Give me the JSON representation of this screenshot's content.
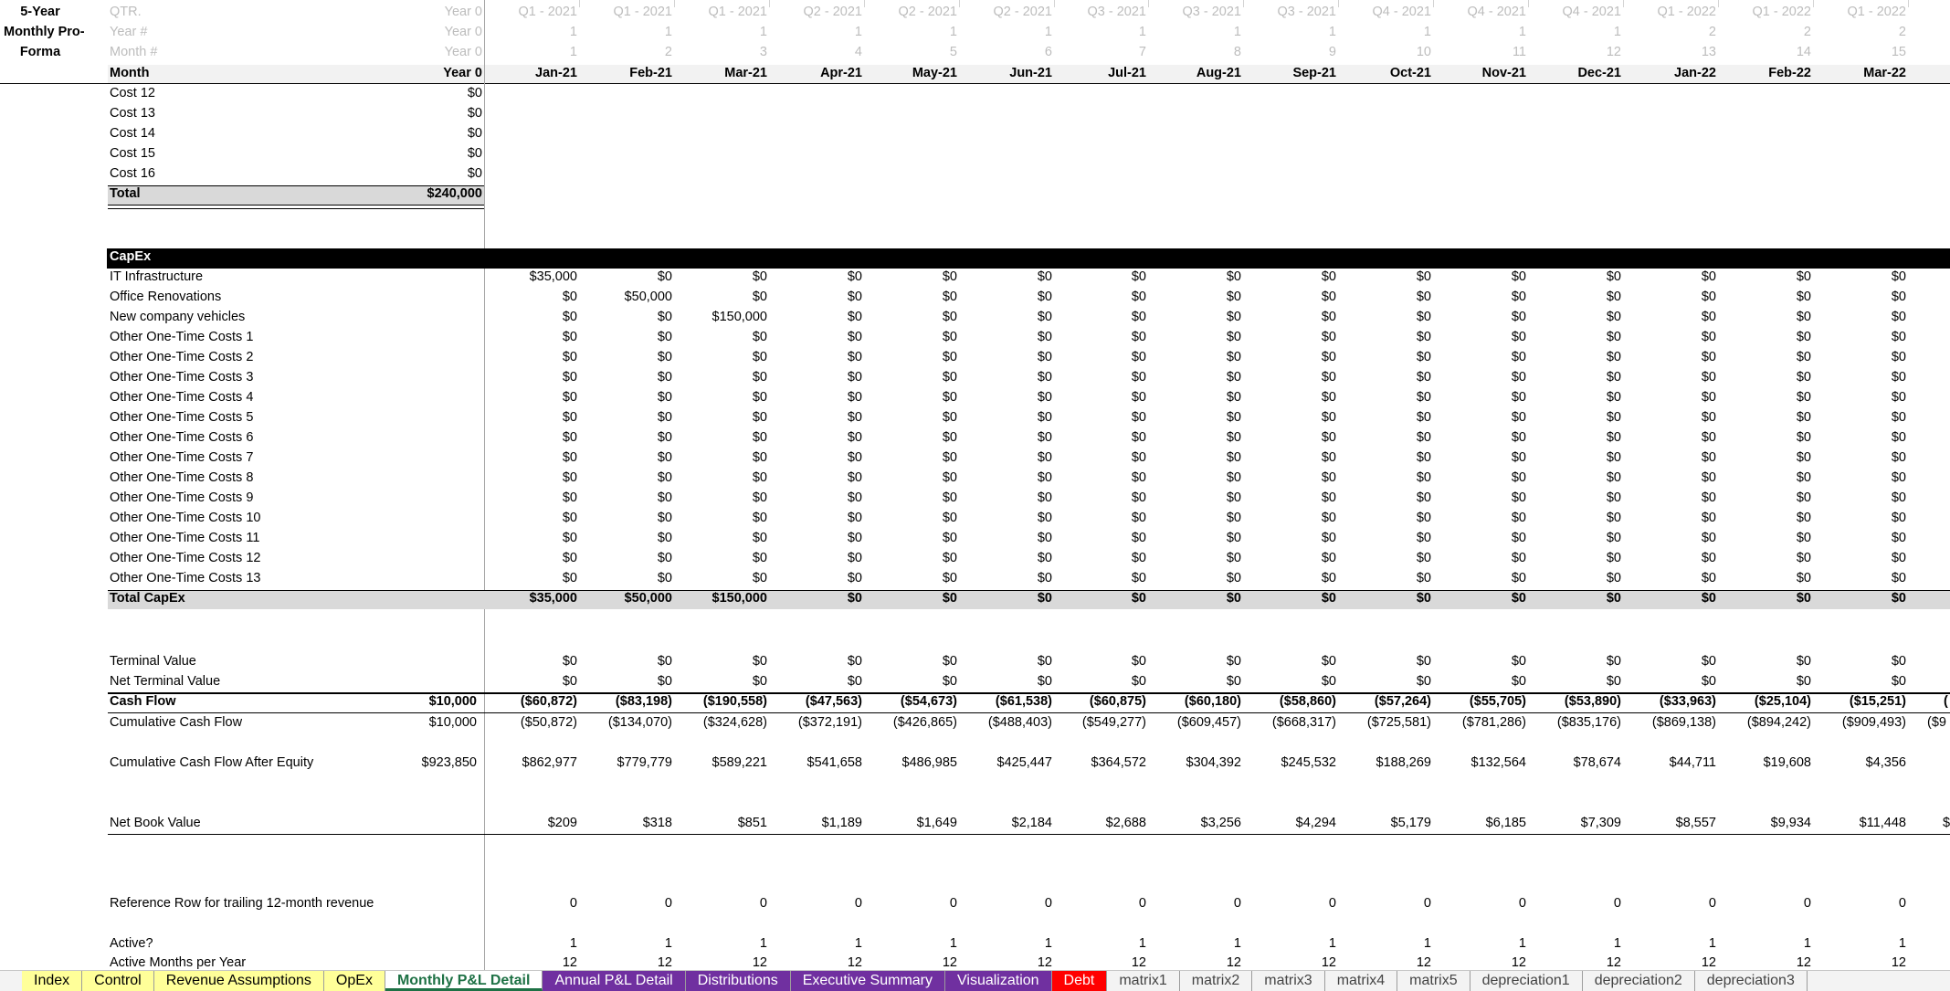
{
  "title": {
    "line1": "5-Year",
    "line2": "Monthly Pro-",
    "line3": "Forma"
  },
  "header_labels": {
    "qtr": "QTR.",
    "year_num": "Year #",
    "month_num": "Month #",
    "month": "Month"
  },
  "year0_header": {
    "qtr": "Year 0",
    "year_num": "Year 0",
    "month_num": "Year 0",
    "month": "Year 0"
  },
  "columns": [
    {
      "qtr": "Q1 - 2021",
      "year": "1",
      "mnum": "1",
      "month": "Jan-21"
    },
    {
      "qtr": "Q1 - 2021",
      "year": "1",
      "mnum": "2",
      "month": "Feb-21"
    },
    {
      "qtr": "Q1 - 2021",
      "year": "1",
      "mnum": "3",
      "month": "Mar-21"
    },
    {
      "qtr": "Q2 - 2021",
      "year": "1",
      "mnum": "4",
      "month": "Apr-21"
    },
    {
      "qtr": "Q2 - 2021",
      "year": "1",
      "mnum": "5",
      "month": "May-21"
    },
    {
      "qtr": "Q2 - 2021",
      "year": "1",
      "mnum": "6",
      "month": "Jun-21"
    },
    {
      "qtr": "Q3 - 2021",
      "year": "1",
      "mnum": "7",
      "month": "Jul-21"
    },
    {
      "qtr": "Q3 - 2021",
      "year": "1",
      "mnum": "8",
      "month": "Aug-21"
    },
    {
      "qtr": "Q3 - 2021",
      "year": "1",
      "mnum": "9",
      "month": "Sep-21"
    },
    {
      "qtr": "Q4 - 2021",
      "year": "1",
      "mnum": "10",
      "month": "Oct-21"
    },
    {
      "qtr": "Q4 - 2021",
      "year": "1",
      "mnum": "11",
      "month": "Nov-21"
    },
    {
      "qtr": "Q4 - 2021",
      "year": "1",
      "mnum": "12",
      "month": "Dec-21"
    },
    {
      "qtr": "Q1 - 2022",
      "year": "2",
      "mnum": "13",
      "month": "Jan-22"
    },
    {
      "qtr": "Q1 - 2022",
      "year": "2",
      "mnum": "14",
      "month": "Feb-22"
    },
    {
      "qtr": "Q1 - 2022",
      "year": "2",
      "mnum": "15",
      "month": "Mar-22"
    }
  ],
  "cost_rows": [
    {
      "label": "Cost 12",
      "year0": "$0"
    },
    {
      "label": "Cost 13",
      "year0": "$0"
    },
    {
      "label": "Cost 14",
      "year0": "$0"
    },
    {
      "label": "Cost 15",
      "year0": "$0"
    },
    {
      "label": "Cost 16",
      "year0": "$0"
    }
  ],
  "cost_total": {
    "label": "Total",
    "year0": "$240,000"
  },
  "capex_header": "CapEx",
  "capex_rows": [
    {
      "label": "IT Infrastructure",
      "values": [
        "$35,000",
        "$0",
        "$0",
        "$0",
        "$0",
        "$0",
        "$0",
        "$0",
        "$0",
        "$0",
        "$0",
        "$0",
        "$0",
        "$0",
        "$0"
      ]
    },
    {
      "label": "Office Renovations",
      "values": [
        "$0",
        "$50,000",
        "$0",
        "$0",
        "$0",
        "$0",
        "$0",
        "$0",
        "$0",
        "$0",
        "$0",
        "$0",
        "$0",
        "$0",
        "$0"
      ]
    },
    {
      "label": "New company vehicles",
      "values": [
        "$0",
        "$0",
        "$150,000",
        "$0",
        "$0",
        "$0",
        "$0",
        "$0",
        "$0",
        "$0",
        "$0",
        "$0",
        "$0",
        "$0",
        "$0"
      ]
    },
    {
      "label": "Other One-Time Costs 1",
      "values": [
        "$0",
        "$0",
        "$0",
        "$0",
        "$0",
        "$0",
        "$0",
        "$0",
        "$0",
        "$0",
        "$0",
        "$0",
        "$0",
        "$0",
        "$0"
      ]
    },
    {
      "label": "Other One-Time Costs 2",
      "values": [
        "$0",
        "$0",
        "$0",
        "$0",
        "$0",
        "$0",
        "$0",
        "$0",
        "$0",
        "$0",
        "$0",
        "$0",
        "$0",
        "$0",
        "$0"
      ]
    },
    {
      "label": "Other One-Time Costs 3",
      "values": [
        "$0",
        "$0",
        "$0",
        "$0",
        "$0",
        "$0",
        "$0",
        "$0",
        "$0",
        "$0",
        "$0",
        "$0",
        "$0",
        "$0",
        "$0"
      ]
    },
    {
      "label": "Other One-Time Costs 4",
      "values": [
        "$0",
        "$0",
        "$0",
        "$0",
        "$0",
        "$0",
        "$0",
        "$0",
        "$0",
        "$0",
        "$0",
        "$0",
        "$0",
        "$0",
        "$0"
      ]
    },
    {
      "label": "Other One-Time Costs 5",
      "values": [
        "$0",
        "$0",
        "$0",
        "$0",
        "$0",
        "$0",
        "$0",
        "$0",
        "$0",
        "$0",
        "$0",
        "$0",
        "$0",
        "$0",
        "$0"
      ]
    },
    {
      "label": "Other One-Time Costs 6",
      "values": [
        "$0",
        "$0",
        "$0",
        "$0",
        "$0",
        "$0",
        "$0",
        "$0",
        "$0",
        "$0",
        "$0",
        "$0",
        "$0",
        "$0",
        "$0"
      ]
    },
    {
      "label": "Other One-Time Costs 7",
      "values": [
        "$0",
        "$0",
        "$0",
        "$0",
        "$0",
        "$0",
        "$0",
        "$0",
        "$0",
        "$0",
        "$0",
        "$0",
        "$0",
        "$0",
        "$0"
      ]
    },
    {
      "label": "Other One-Time Costs 8",
      "values": [
        "$0",
        "$0",
        "$0",
        "$0",
        "$0",
        "$0",
        "$0",
        "$0",
        "$0",
        "$0",
        "$0",
        "$0",
        "$0",
        "$0",
        "$0"
      ]
    },
    {
      "label": "Other One-Time Costs 9",
      "values": [
        "$0",
        "$0",
        "$0",
        "$0",
        "$0",
        "$0",
        "$0",
        "$0",
        "$0",
        "$0",
        "$0",
        "$0",
        "$0",
        "$0",
        "$0"
      ]
    },
    {
      "label": "Other One-Time Costs 10",
      "values": [
        "$0",
        "$0",
        "$0",
        "$0",
        "$0",
        "$0",
        "$0",
        "$0",
        "$0",
        "$0",
        "$0",
        "$0",
        "$0",
        "$0",
        "$0"
      ]
    },
    {
      "label": "Other One-Time Costs 11",
      "values": [
        "$0",
        "$0",
        "$0",
        "$0",
        "$0",
        "$0",
        "$0",
        "$0",
        "$0",
        "$0",
        "$0",
        "$0",
        "$0",
        "$0",
        "$0"
      ]
    },
    {
      "label": "Other One-Time Costs 12",
      "values": [
        "$0",
        "$0",
        "$0",
        "$0",
        "$0",
        "$0",
        "$0",
        "$0",
        "$0",
        "$0",
        "$0",
        "$0",
        "$0",
        "$0",
        "$0"
      ]
    },
    {
      "label": "Other One-Time Costs 13",
      "values": [
        "$0",
        "$0",
        "$0",
        "$0",
        "$0",
        "$0",
        "$0",
        "$0",
        "$0",
        "$0",
        "$0",
        "$0",
        "$0",
        "$0",
        "$0"
      ]
    }
  ],
  "capex_total": {
    "label": "Total CapEx",
    "values": [
      "$35,000",
      "$50,000",
      "$150,000",
      "$0",
      "$0",
      "$0",
      "$0",
      "$0",
      "$0",
      "$0",
      "$0",
      "$0",
      "$0",
      "$0",
      "$0"
    ]
  },
  "terminal_rows": [
    {
      "label": "Terminal Value",
      "values": [
        "$0",
        "$0",
        "$0",
        "$0",
        "$0",
        "$0",
        "$0",
        "$0",
        "$0",
        "$0",
        "$0",
        "$0",
        "$0",
        "$0",
        "$0"
      ]
    },
    {
      "label": "Net Terminal Value",
      "values": [
        "$0",
        "$0",
        "$0",
        "$0",
        "$0",
        "$0",
        "$0",
        "$0",
        "$0",
        "$0",
        "$0",
        "$0",
        "$0",
        "$0",
        "$0"
      ]
    }
  ],
  "cash_flow": {
    "label": "Cash Flow",
    "year0": "$10,000",
    "values": [
      "($60,872)",
      "($83,198)",
      "($190,558)",
      "($47,563)",
      "($54,673)",
      "($61,538)",
      "($60,875)",
      "($60,180)",
      "($58,860)",
      "($57,264)",
      "($55,705)",
      "($53,890)",
      "($33,963)",
      "($25,104)",
      "($15,251)"
    ],
    "overflow": "("
  },
  "cum_cash_flow": {
    "label": "Cumulative Cash Flow",
    "year0": "$10,000",
    "values": [
      "($50,872)",
      "($134,070)",
      "($324,628)",
      "($372,191)",
      "($426,865)",
      "($488,403)",
      "($549,277)",
      "($609,457)",
      "($668,317)",
      "($725,581)",
      "($781,286)",
      "($835,176)",
      "($869,138)",
      "($894,242)",
      "($909,493)"
    ],
    "overflow": "($9"
  },
  "cum_after_equity": {
    "label": "Cumulative Cash Flow After Equity",
    "year0": "$923,850",
    "values": [
      "$862,977",
      "$779,779",
      "$589,221",
      "$541,658",
      "$486,985",
      "$425,447",
      "$364,572",
      "$304,392",
      "$245,532",
      "$188,269",
      "$132,564",
      "$78,674",
      "$44,711",
      "$19,608",
      "$4,356"
    ],
    "overflow": "("
  },
  "net_book_value": {
    "label": "Net Book Value",
    "values": [
      "$209",
      "$318",
      "$851",
      "$1,189",
      "$1,649",
      "$2,184",
      "$2,688",
      "$3,256",
      "$4,294",
      "$5,179",
      "$6,185",
      "$7,309",
      "$8,557",
      "$9,934",
      "$11,448"
    ],
    "overflow": "$"
  },
  "reference_row": {
    "label": "Reference Row for trailing 12-month revenue",
    "values": [
      "0",
      "0",
      "0",
      "0",
      "0",
      "0",
      "0",
      "0",
      "0",
      "0",
      "0",
      "0",
      "0",
      "0",
      "0"
    ]
  },
  "active_row": {
    "label": "Active?",
    "values": [
      "1",
      "1",
      "1",
      "1",
      "1",
      "1",
      "1",
      "1",
      "1",
      "1",
      "1",
      "1",
      "1",
      "1",
      "1"
    ]
  },
  "active_months_row": {
    "label": "Active Months per Year",
    "values": [
      "12",
      "12",
      "12",
      "12",
      "12",
      "12",
      "12",
      "12",
      "12",
      "12",
      "12",
      "12",
      "12",
      "12",
      "12"
    ]
  },
  "tabs": [
    {
      "label": "Index",
      "style": "yellow"
    },
    {
      "label": "Control",
      "style": "yellow"
    },
    {
      "label": "Revenue Assumptions",
      "style": "yellow"
    },
    {
      "label": "OpEx",
      "style": "yellow"
    },
    {
      "label": "Monthly P&L Detail",
      "style": "active"
    },
    {
      "label": "Annual P&L Detail",
      "style": "purple"
    },
    {
      "label": "Distributions",
      "style": "purple"
    },
    {
      "label": "Executive Summary",
      "style": "purple"
    },
    {
      "label": "Visualization",
      "style": "purple"
    },
    {
      "label": "Debt",
      "style": "red"
    },
    {
      "label": "matrix1",
      "style": "plain"
    },
    {
      "label": "matrix2",
      "style": "plain"
    },
    {
      "label": "matrix3",
      "style": "plain"
    },
    {
      "label": "matrix4",
      "style": "plain"
    },
    {
      "label": "matrix5",
      "style": "plain"
    },
    {
      "label": "depreciation1",
      "style": "plain"
    },
    {
      "label": "depreciation2",
      "style": "plain"
    },
    {
      "label": "depreciation3",
      "style": "plain"
    }
  ],
  "colors": {
    "active_tab": "#1e7145",
    "purple_tab": "#7030a0",
    "red_tab": "#ff0000",
    "yellow_tab": "#ffff99",
    "header_fill": "#d9d9d9",
    "band": "#000000"
  }
}
